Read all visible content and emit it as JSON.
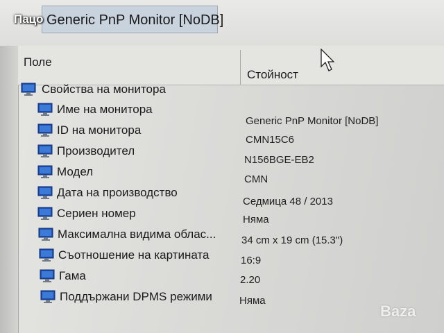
{
  "window": {
    "title": "Generic PnP Monitor [NoDB]"
  },
  "overlay": {
    "owner": "Пацо",
    "watermark": "Baza"
  },
  "columns": {
    "field": "Поле",
    "value": "Стойност"
  },
  "group": {
    "label": "Свойства на монитора",
    "icon": "monitor-icon"
  },
  "properties": [
    {
      "label": "Име на монитора",
      "value": "Generic PnP Monitor [NoDB]"
    },
    {
      "label": "ID на монитора",
      "value": "CMN15C6"
    },
    {
      "label": "Производител",
      "value": "N156BGE-EB2"
    },
    {
      "label": "Модел",
      "value": "CMN"
    },
    {
      "label": "Дата на производство",
      "value": "Седмица 48 / 2013"
    },
    {
      "label": "Сериен номер",
      "value": "Няма"
    },
    {
      "label": "Максимална видима облас...",
      "value": "34 cm x 19 cm (15.3\")"
    },
    {
      "label": "Съотношение на картината",
      "value": "16:9"
    },
    {
      "label": "Гама",
      "value": "2.20"
    },
    {
      "label": "Поддържани DPMS режими",
      "value": "Няма"
    }
  ],
  "colors": {
    "title_highlight": "#c8d3de",
    "icon_blue": "#1f4fb0"
  }
}
